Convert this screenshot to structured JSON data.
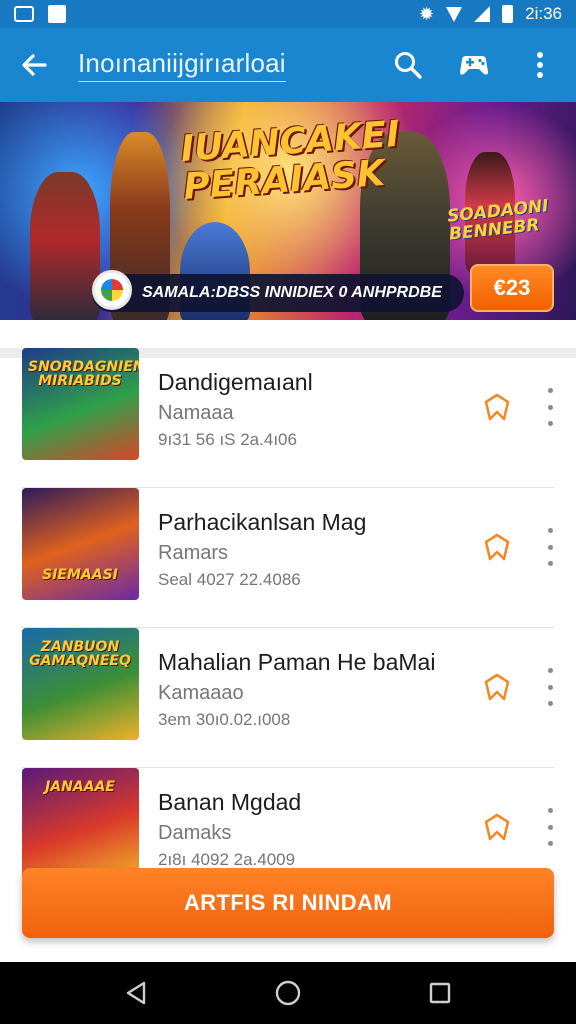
{
  "status_bar": {
    "time": "2i:36",
    "icons": [
      "voicemail-icon",
      "photo-icon",
      "settings-icon",
      "wifi-icon",
      "signal-icon",
      "battery-icon"
    ]
  },
  "app_bar": {
    "title": "Inoınaniijgirıarloai",
    "back_icon": "arrow-back-icon",
    "actions": [
      "search-icon",
      "gamepad-icon",
      "more-vert-icon"
    ]
  },
  "banner": {
    "title": "IUANCAKEI PERAIASK",
    "side_logo": "SOADAONI BENNEBR",
    "promo_text": "SAMALA:DBSS INNIDIEX 0 ANHPRDBE",
    "price": "€23"
  },
  "games": [
    {
      "name": "Dandigemaıanl",
      "developer": "Namaaa",
      "meta": "9ı31 56 ıS 2a.4ı06",
      "thumb_label": "SNORDAGNIEN MIRIABIDS",
      "thumb_colors": [
        "#1e3b8a",
        "#2fa04a",
        "#d9462a"
      ]
    },
    {
      "name": "Parhacikanlsan Mag",
      "developer": "Ramars",
      "meta": "Seal 4027 22.4086",
      "thumb_label": "SIEMAASI",
      "thumb_colors": [
        "#2d1b5c",
        "#e0621e",
        "#6b2aa6"
      ]
    },
    {
      "name": "Mahalian Paman He baMai",
      "developer": "Kamaaao",
      "meta": "3em 30ı0.02.ı008",
      "thumb_label": "ZANBUON GAMAQNEEQ",
      "thumb_colors": [
        "#1a6aa8",
        "#3d8f35",
        "#f0b12a"
      ]
    },
    {
      "name": "Banan Mɡdad",
      "developer": "Damaks",
      "meta": "2ı8ı 4092 2a.4009",
      "thumb_label": "JANAAAE",
      "thumb_colors": [
        "#5a1a7a",
        "#d93a2a",
        "#f3b12a"
      ]
    }
  ],
  "cta": {
    "label": "ARTFIS RI NINDAM"
  },
  "nav_bar": {
    "buttons": [
      "back-triangle-icon",
      "home-circle-icon",
      "recents-square-icon"
    ]
  },
  "colors": {
    "app_bar": "#1a86cf",
    "status_bar": "#1679c1",
    "accent": "#f26a10",
    "bookmark": "#f08a28"
  }
}
